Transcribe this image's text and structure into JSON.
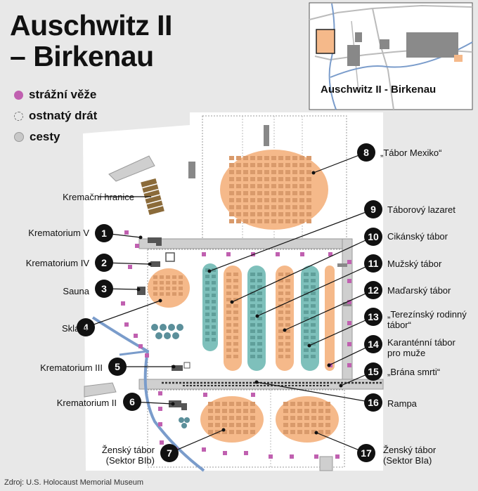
{
  "title_line1": "Auschwitz II",
  "title_line2": "– Birkenau",
  "legend": {
    "towers": "strážní věže",
    "wire": "ostnatý drát",
    "roads": "cesty"
  },
  "inset": {
    "label": "Auschwitz II - Birkenau"
  },
  "colors": {
    "tower": "#c060b0",
    "orange": "#f5b98a",
    "teal": "#7ec0bb",
    "river": "#7a9ccb"
  },
  "markers": [
    {
      "num": "1",
      "label": "Krematorium V"
    },
    {
      "num": "2",
      "label": "Krematorium IV"
    },
    {
      "num": "3",
      "label": "Sauna"
    },
    {
      "num": "4",
      "label": "Sklady"
    },
    {
      "num": "5",
      "label": "Krematorium III"
    },
    {
      "num": "6",
      "label": "Krematorium II"
    },
    {
      "num": "7",
      "label": "Ženský tábor",
      "label2": "(Sektor BIb)"
    },
    {
      "num": "8",
      "label": "„Tábor Mexiko“"
    },
    {
      "num": "9",
      "label": "Táborový lazaret"
    },
    {
      "num": "10",
      "label": "Cikánský tábor"
    },
    {
      "num": "11",
      "label": "Mužský tábor"
    },
    {
      "num": "12",
      "label": "Maďarský tábor"
    },
    {
      "num": "13",
      "label": "„Terezínský rodinný",
      "label2": "tábor“"
    },
    {
      "num": "14",
      "label": "Karanténní tábor",
      "label2": "pro muže"
    },
    {
      "num": "15",
      "label": "„Brána smrti“"
    },
    {
      "num": "16",
      "label": "Rampa"
    },
    {
      "num": "17",
      "label": "Ženský tábor",
      "label2": "(Sektor BIa)"
    }
  ],
  "kremacni_hranice": "Kremační hranice",
  "source": "Zdroj: U.S. Holocaust Memorial Museum"
}
